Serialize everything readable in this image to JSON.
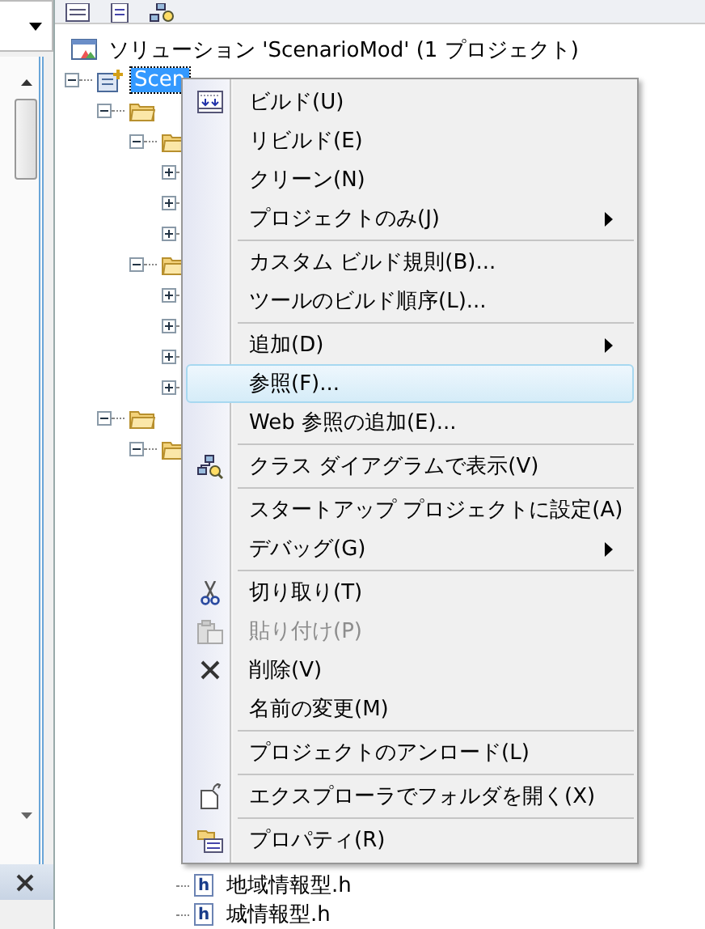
{
  "tree": [
    {
      "kind": "solution",
      "label": "ソリューション 'ScenarioMod' (1 プロジェクト)",
      "children": [
        {
          "kind": "project",
          "label": "Scen",
          "selected": true,
          "expanded": true,
          "children": [
            {
              "kind": "folder",
              "expanded": true,
              "children": [
                {
                  "kind": "folder",
                  "expanded": true,
                  "children": [
                    {
                      "kind": "node",
                      "expanded": false
                    },
                    {
                      "kind": "node",
                      "expanded": false
                    },
                    {
                      "kind": "node",
                      "expanded": false
                    }
                  ]
                },
                {
                  "kind": "folder",
                  "expanded": true,
                  "children": [
                    {
                      "kind": "node",
                      "expanded": false
                    },
                    {
                      "kind": "node",
                      "expanded": false
                    },
                    {
                      "kind": "node",
                      "expanded": false
                    },
                    {
                      "kind": "node",
                      "expanded": false
                    }
                  ]
                }
              ]
            },
            {
              "kind": "folder",
              "expanded": true,
              "children": [
                {
                  "kind": "folder",
                  "expanded": true,
                  "children": [
                    {
                      "kind": "file",
                      "icon_text": "h",
                      "label": "地域情報型.h"
                    },
                    {
                      "kind": "file",
                      "icon_text": "h",
                      "label": "城情報型.h"
                    }
                  ]
                }
              ]
            }
          ]
        }
      ]
    }
  ],
  "context_menu": {
    "groups": [
      [
        {
          "label": "ビルド(U)",
          "selected": false,
          "disabled": false,
          "submenu": false
        },
        {
          "label": "リビルド(E)",
          "selected": false,
          "disabled": false,
          "submenu": false
        },
        {
          "label": "クリーン(N)",
          "selected": false,
          "disabled": false,
          "submenu": false
        },
        {
          "label": "プロジェクトのみ(J)",
          "selected": false,
          "disabled": false,
          "submenu": true
        }
      ],
      [
        {
          "label": "カスタム ビルド規則(B)...",
          "selected": false,
          "disabled": false,
          "submenu": false
        },
        {
          "label": "ツールのビルド順序(L)...",
          "selected": false,
          "disabled": false,
          "submenu": false
        }
      ],
      [
        {
          "label": "追加(D)",
          "selected": false,
          "disabled": false,
          "submenu": true
        },
        {
          "label": "参照(F)...",
          "selected": true,
          "disabled": false,
          "submenu": false
        },
        {
          "label": "Web 参照の追加(E)...",
          "selected": false,
          "disabled": false,
          "submenu": false
        }
      ],
      [
        {
          "label": "クラス ダイアグラムで表示(V)",
          "selected": false,
          "disabled": false,
          "submenu": false
        }
      ],
      [
        {
          "label": "スタートアップ プロジェクトに設定(A)",
          "selected": false,
          "disabled": false,
          "submenu": false
        },
        {
          "label": "デバッグ(G)",
          "selected": false,
          "disabled": false,
          "submenu": true
        }
      ],
      [
        {
          "label": "切り取り(T)",
          "selected": false,
          "disabled": false,
          "submenu": false
        },
        {
          "label": "貼り付け(P)",
          "selected": false,
          "disabled": true,
          "submenu": false
        },
        {
          "label": "削除(V)",
          "selected": false,
          "disabled": false,
          "submenu": false
        },
        {
          "label": "名前の変更(M)",
          "selected": false,
          "disabled": false,
          "submenu": false
        }
      ],
      [
        {
          "label": "プロジェクトのアンロード(L)",
          "selected": false,
          "disabled": false,
          "submenu": false
        }
      ],
      [
        {
          "label": "エクスプローラでフォルダを開く(X)",
          "selected": false,
          "disabled": false,
          "submenu": false
        }
      ],
      [
        {
          "label": "プロパティ(R)",
          "selected": false,
          "disabled": false,
          "submenu": false
        }
      ]
    ]
  }
}
